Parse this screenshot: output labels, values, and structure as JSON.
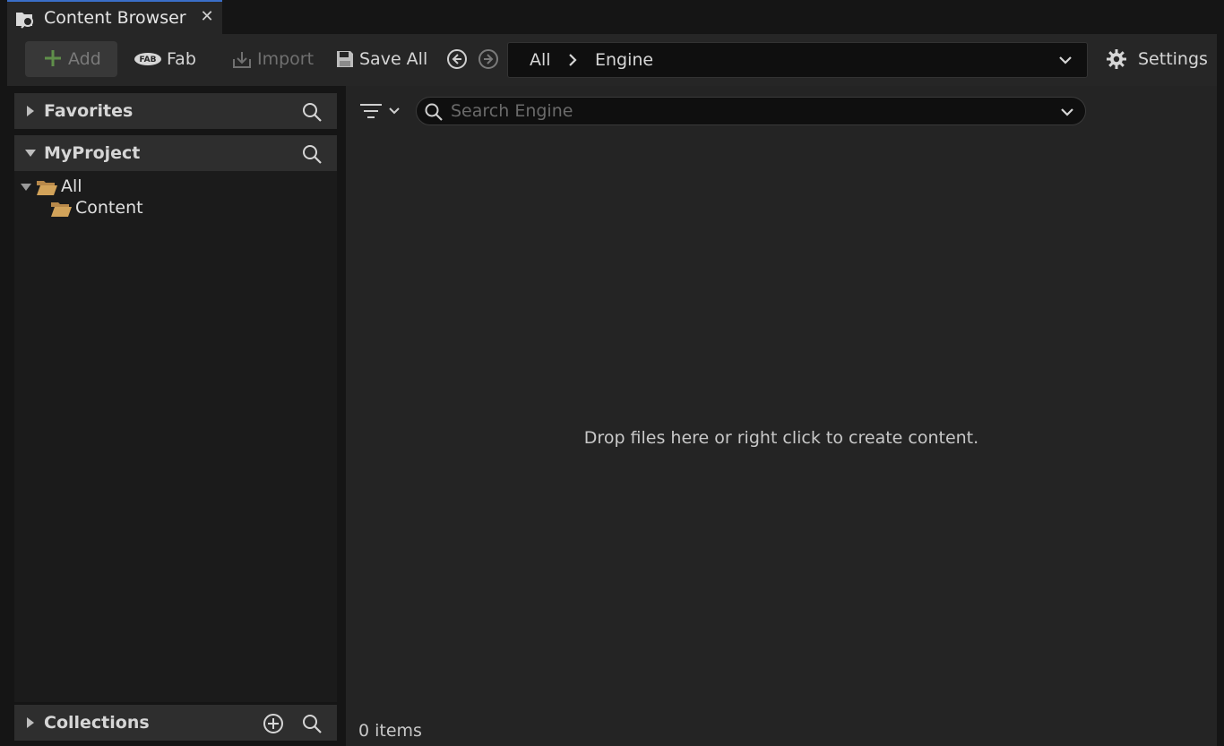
{
  "tab": {
    "title": "Content Browser",
    "close_glyph": "✕"
  },
  "toolbar": {
    "add_label": "Add",
    "fab_label": "Fab",
    "fab_logo_text": "FAB",
    "import_label": "Import",
    "save_all_label": "Save All",
    "settings_label": "Settings"
  },
  "path": {
    "segments": [
      "All",
      "Engine"
    ]
  },
  "sidebar": {
    "favorites_label": "Favorites",
    "project_label": "MyProject",
    "tree": [
      {
        "label": "All"
      },
      {
        "label": "Content"
      }
    ],
    "collections_label": "Collections"
  },
  "search": {
    "placeholder": "Search Engine",
    "value": ""
  },
  "main": {
    "empty_message": "Drop files here or right click to create content.",
    "item_count": "0 items"
  },
  "colors": {
    "folder": "#d2a35a",
    "add_plus": "#5f8f4a",
    "accent_tab": "#3a6ec8"
  }
}
